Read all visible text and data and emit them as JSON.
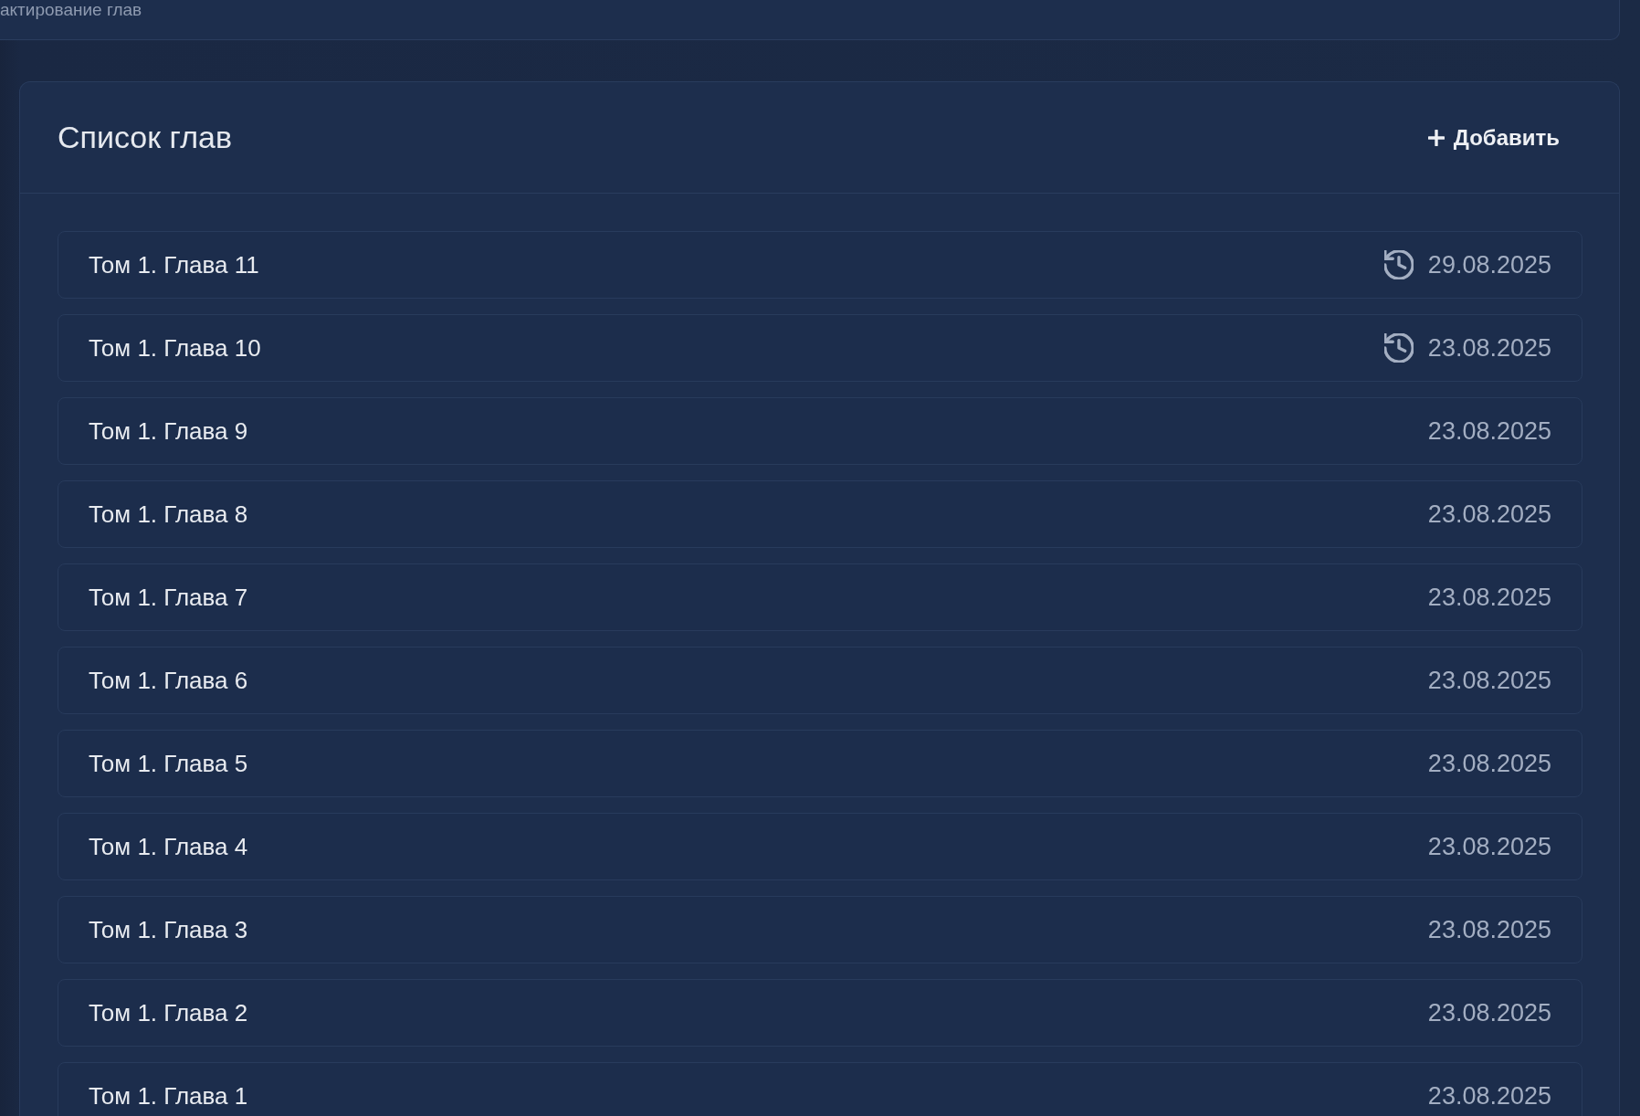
{
  "top_panel": {
    "title": "актирование глав"
  },
  "chapters_card": {
    "title": "Список глав",
    "add_button": {
      "label": "Добавить"
    },
    "chapters": [
      {
        "title": "Том 1. Глава 11",
        "date": "29.08.2025",
        "updated": true
      },
      {
        "title": "Том 1. Глава 10",
        "date": "23.08.2025",
        "updated": true
      },
      {
        "title": "Том 1. Глава 9",
        "date": "23.08.2025",
        "updated": false
      },
      {
        "title": "Том 1. Глава 8",
        "date": "23.08.2025",
        "updated": false
      },
      {
        "title": "Том 1. Глава 7",
        "date": "23.08.2025",
        "updated": false
      },
      {
        "title": "Том 1. Глава 6",
        "date": "23.08.2025",
        "updated": false
      },
      {
        "title": "Том 1. Глава 5",
        "date": "23.08.2025",
        "updated": false
      },
      {
        "title": "Том 1. Глава 4",
        "date": "23.08.2025",
        "updated": false
      },
      {
        "title": "Том 1. Глава 3",
        "date": "23.08.2025",
        "updated": false
      },
      {
        "title": "Том 1. Глава 2",
        "date": "23.08.2025",
        "updated": false
      },
      {
        "title": "Том 1. Глава 1",
        "date": "23.08.2025",
        "updated": false
      }
    ]
  }
}
